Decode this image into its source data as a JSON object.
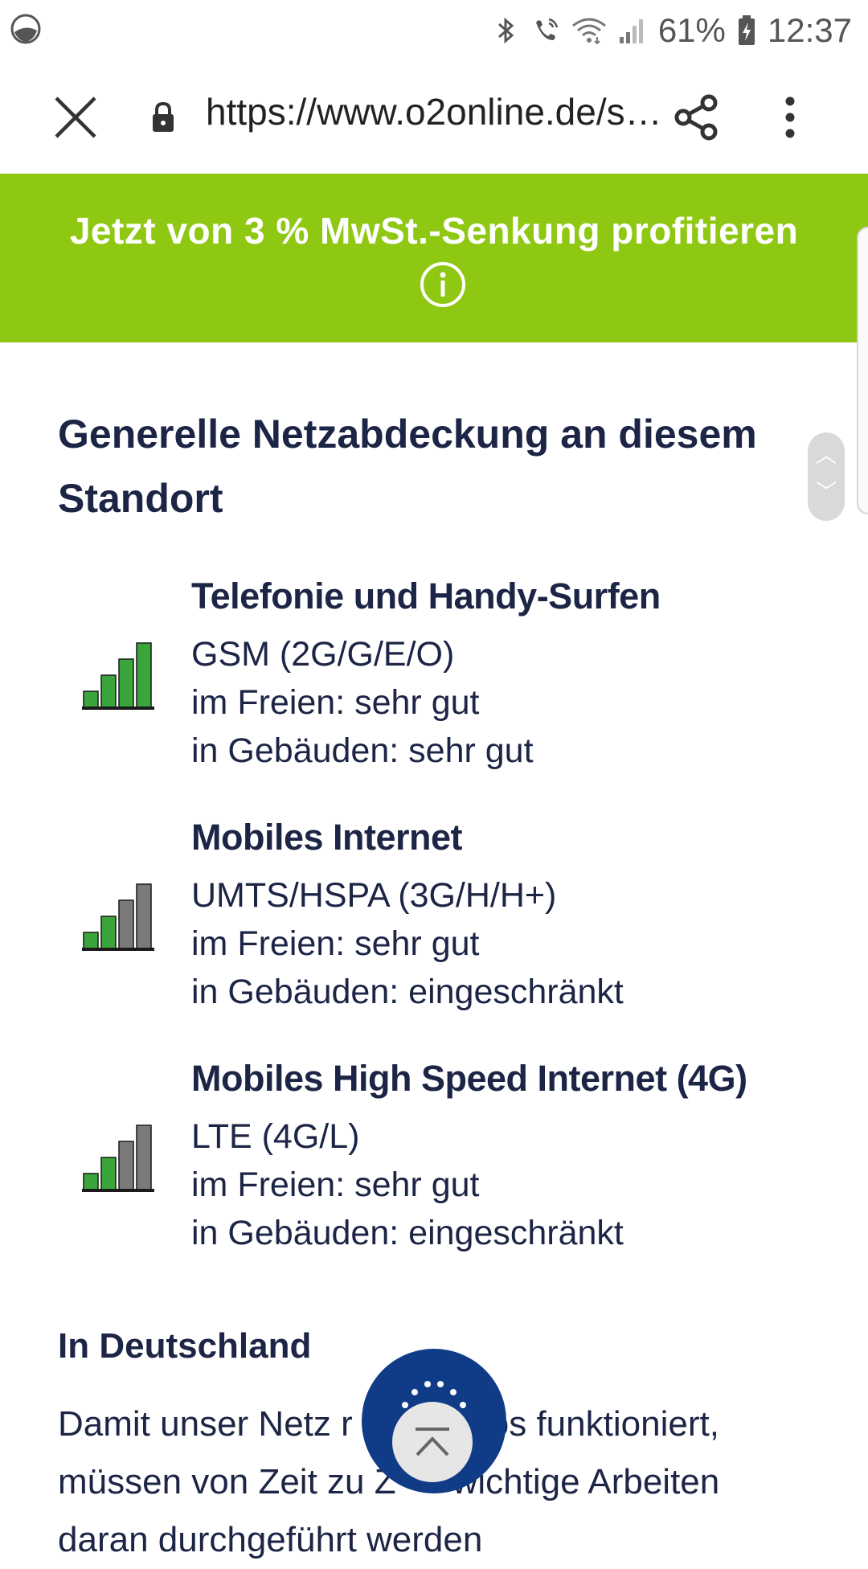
{
  "status_bar": {
    "battery": "61%",
    "time": "12:37",
    "icons": [
      "app-icon",
      "bluetooth-icon",
      "wifi-call-icon",
      "wifi-icon",
      "signal-icon",
      "battery-charging-icon"
    ]
  },
  "browser": {
    "url": "https://www.o2online.de/s…",
    "icons": {
      "close": "close-icon",
      "lock": "lock-icon",
      "share": "share-icon",
      "menu": "more-vert-icon"
    }
  },
  "banner": {
    "text": "Jetzt von 3 % MwSt.-Senkung profitieren",
    "icon": "info-icon",
    "color": "#8fc813"
  },
  "content": {
    "title": "Generelle Netzabdeckung an diesem Standort",
    "items": [
      {
        "title": "Telefonie und Handy-Surfen",
        "tech": "GSM (2G/G/E/O)",
        "outdoor": "im Freien: sehr gut",
        "indoor": "in Gebäuden: sehr gut",
        "signal_level_of_4": 4
      },
      {
        "title": "Mobiles Internet",
        "tech": "UMTS/HSPA (3G/H/H+)",
        "outdoor": "im Freien: sehr gut",
        "indoor": "in Gebäuden: eingeschränkt",
        "signal_level_of_4": 2
      },
      {
        "title": "Mobiles High Speed Internet (4G)",
        "tech": "LTE (4G/L)",
        "outdoor": "im Freien: sehr gut",
        "indoor": "in Gebäuden: eingeschränkt",
        "signal_level_of_4": 2
      }
    ],
    "section_title": "In Deutschland",
    "paragraph_line1": "Damit unser Netz r",
    "paragraph_line1b": "os funktioniert,",
    "paragraph_line2": "müssen von Zeit zu Z",
    "paragraph_line2b": "wichtige Arbeiten",
    "paragraph_line3": "daran durchgeführt werden"
  },
  "colors": {
    "heading": "#1c2545",
    "signal_active": "#3aa53a",
    "signal_inactive": "#7a7a7a",
    "fab": "#0f3b87"
  }
}
